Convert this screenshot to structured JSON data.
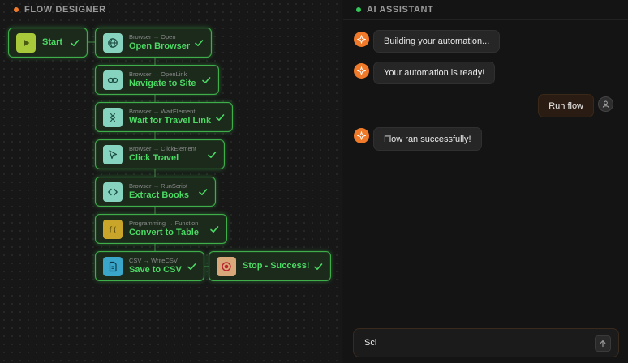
{
  "flow_designer": {
    "title": "FLOW DESIGNER",
    "nodes": [
      {
        "sub": "",
        "title": "Start",
        "icon": "play-icon"
      },
      {
        "sub": "Browser → Open",
        "title": "Open Browser",
        "icon": "globe-icon"
      },
      {
        "sub": "Browser → OpenLink",
        "title": "Navigate to Site",
        "icon": "link-icon"
      },
      {
        "sub": "Browser → WaitElement",
        "title": "Wait for Travel Link",
        "icon": "hourglass-icon"
      },
      {
        "sub": "Browser → ClickElement",
        "title": "Click Travel",
        "icon": "cursor-icon"
      },
      {
        "sub": "Browser → RunScript",
        "title": "Extract Books",
        "icon": "code-icon"
      },
      {
        "sub": "Programming → Function",
        "title": "Convert to Table",
        "icon": "function-icon"
      },
      {
        "sub": "CSV → WriteCSV",
        "title": "Save to CSV",
        "icon": "file-icon"
      },
      {
        "sub": "",
        "title": "Stop - Success!",
        "icon": "stop-icon"
      }
    ],
    "colors": {
      "node_border": "#3fae4a",
      "node_title": "#4cd964"
    }
  },
  "assistant": {
    "title": "AI ASSISTANT",
    "messages": [
      {
        "role": "bot",
        "text": "Building your automation..."
      },
      {
        "role": "bot",
        "text": "Your automation is ready!"
      },
      {
        "role": "user",
        "text": "Run flow"
      },
      {
        "role": "bot",
        "text": "Flow ran successfully!"
      }
    ],
    "input": {
      "value": "Scl",
      "placeholder": ""
    },
    "colors": {
      "accent": "#f07a2a"
    }
  }
}
